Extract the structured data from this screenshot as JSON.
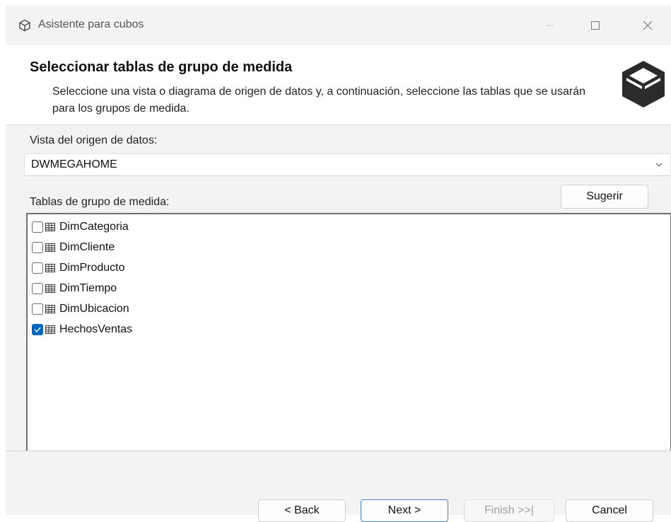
{
  "window": {
    "title": "Asistente para cubos"
  },
  "header": {
    "title": "Seleccionar tablas de grupo de medida",
    "description": "Seleccione una vista o diagrama de origen de datos y, a continuación, seleccione las tablas que se usarán para los grupos de medida."
  },
  "data_source_view": {
    "label": "Vista del origen de datos:",
    "selected": "DWMEGAHOME"
  },
  "measure_groups": {
    "label": "Tablas de grupo de medida:",
    "suggest_label": "Sugerir",
    "tables": [
      {
        "name": "DimCategoria",
        "checked": false
      },
      {
        "name": "DimCliente",
        "checked": false
      },
      {
        "name": "DimProducto",
        "checked": false
      },
      {
        "name": "DimTiempo",
        "checked": false
      },
      {
        "name": "DimUbicacion",
        "checked": false
      },
      {
        "name": "HechosVentas",
        "checked": true
      }
    ]
  },
  "footer": {
    "back_label": "< Back",
    "next_label": "Next >",
    "finish_label": "Finish >>|",
    "cancel_label": "Cancel"
  },
  "icons": {
    "app": "cube-icon",
    "header": "cube-icon",
    "table": "table-icon",
    "dropdown": "chevron-down-icon"
  },
  "colors": {
    "accent": "#0067c0",
    "window_bg": "#f3f3f3"
  }
}
